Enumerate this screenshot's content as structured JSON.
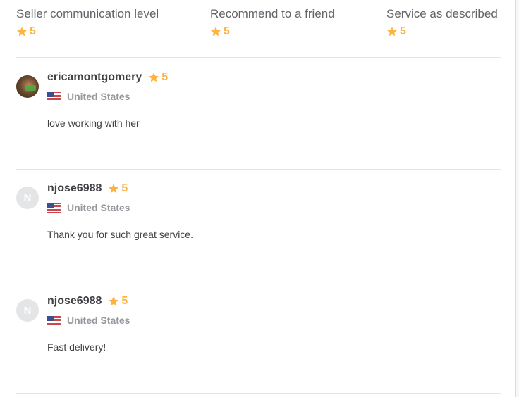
{
  "ratings": [
    {
      "title": "Seller communication level",
      "score": "5"
    },
    {
      "title": "Recommend to a friend",
      "score": "5"
    },
    {
      "title": "Service as described",
      "score": "5"
    }
  ],
  "reviews": [
    {
      "username": "ericamontgomery",
      "score": "5",
      "country": "United States",
      "text": "love working with her",
      "avatar_initial": ""
    },
    {
      "username": "njose6988",
      "score": "5",
      "country": "United States",
      "text": "Thank you for such great service.",
      "avatar_initial": "N"
    },
    {
      "username": "njose6988",
      "score": "5",
      "country": "United States",
      "text": "Fast delivery!",
      "avatar_initial": "N"
    }
  ],
  "colors": {
    "star": "#ffb33e",
    "divider": "#e4e5e7",
    "text": "#404145",
    "muted": "#95979d"
  },
  "icons": {
    "star": "star-icon",
    "flag": "us-flag-icon"
  }
}
